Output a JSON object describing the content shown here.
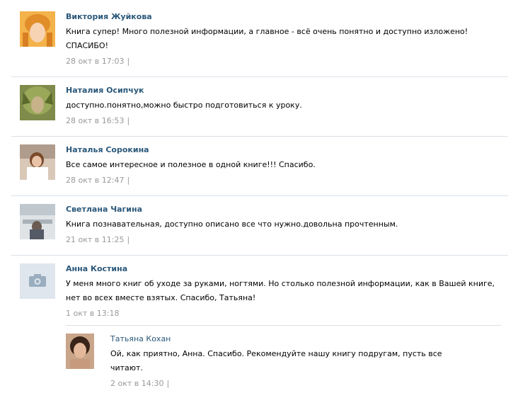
{
  "comments": [
    {
      "author": "Виктория Жуйкова",
      "text_line1": "Книга супер! Много полезной информации, а главное - всё очень понятно и доступно изложено!",
      "text_line2": "СПАСИБО!",
      "date": "28 окт в 17:03",
      "sep": "|"
    },
    {
      "author": "Наталия Осипчук",
      "text_line1": "доступно.понятно,можно быстро подготовиться к уроку.",
      "date": "28 окт в 16:53",
      "sep": "|"
    },
    {
      "author": "Наталья Сорокина",
      "text_line1": "Все самое интересное и полезное в одной книге!!! Спасибо.",
      "date": "28 окт в 12:47",
      "sep": "|"
    },
    {
      "author": "Светлана Чагина",
      "text_line1": "Книга познавательная, доступно описано все что нужно.довольна прочтенным.",
      "date": "21 окт в 11:25",
      "sep": "|"
    },
    {
      "author": "Анна Костина",
      "text_line1": "У меня много книг об уходе за руками, ногтями. Но столько полезной информации, как в Вашей книге,",
      "text_line2": "нет во всех вместе взятых. Спасибо, Татьяна!",
      "date": "1 окт в 13:18"
    }
  ],
  "reply": {
    "author": "Татьяна Кохан",
    "text_line1": "Ой, как приятно, Анна. Спасибо. Рекомендуйте нашу книгу подругам, пусть все",
    "text_line2": "читают.",
    "date": "2 окт в 14:30",
    "sep": "|"
  },
  "colors": {
    "author": "#2b587a",
    "date": "#999999",
    "divider": "#dae1e8"
  }
}
